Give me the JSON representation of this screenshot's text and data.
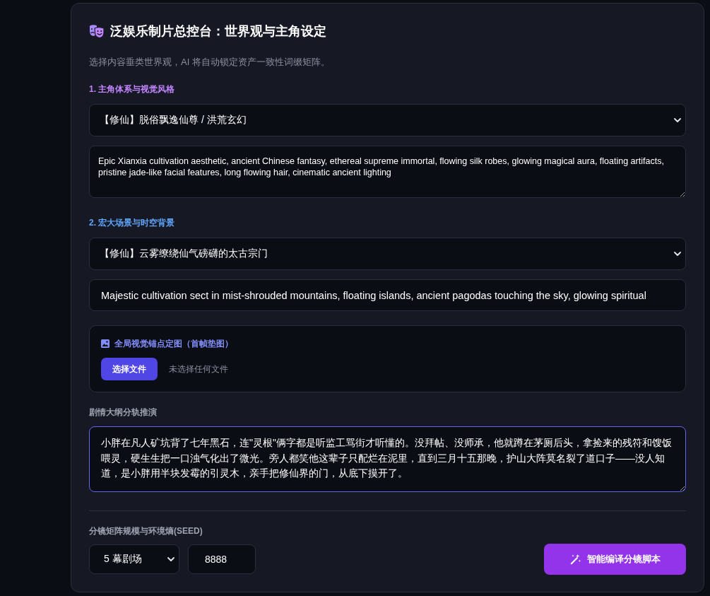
{
  "header": {
    "title": "泛娱乐制片总控台：世界观与主角设定",
    "subtitle": "选择内容垂类世界观，AI 将自动锁定资产一致性词缀矩阵。"
  },
  "character": {
    "label": "1. 主角体系与视觉风格",
    "select": {
      "value": "【修仙】脱俗飘逸仙尊 / 洪荒玄幻"
    },
    "prompt": {
      "value": "Epic Xianxia cultivation aesthetic, ancient Chinese fantasy, ethereal supreme immortal, flowing silk robes, glowing magical aura, floating artifacts, pristine jade-like facial features, long flowing hair, cinematic ancient lighting"
    }
  },
  "scene": {
    "label": "2. 宏大场景与时空背景",
    "select": {
      "value": "【修仙】云雾缭绕仙气磅礴的太古宗门"
    },
    "prompt": {
      "value": "Majestic cultivation sect in mist-shrouded mountains, floating islands, ancient pagodas touching the sky, glowing spiritual"
    }
  },
  "anchor_image": {
    "label": "全局视觉锚点定图（首帧垫图）",
    "button": "选择文件",
    "file_status": "未选择任何文件"
  },
  "plot": {
    "label": "剧情大纲分轨推演",
    "value": "小胖在凡人矿坑背了七年黑石，连\"灵根\"俩字都是听监工骂街才听懂的。没拜帖、没师承，他就蹲在茅厕后头，拿捡来的残符和馊饭喂灵，硬生生把一口浊气化出了微光。旁人都笑他这辈子只配烂在泥里，直到三月十五那晚，护山大阵莫名裂了道口子——没人知道，是小胖用半块发霉的引灵木，亲手把修仙界的门，从底下摸开了。",
    "focused": true
  },
  "matrix": {
    "label": "分镜矩阵规模与环境熵(SEED)",
    "scale": {
      "value": "5 幕剧场"
    },
    "seed": {
      "value": "8888"
    },
    "compile_button": "智能编译分镜脚本"
  }
}
